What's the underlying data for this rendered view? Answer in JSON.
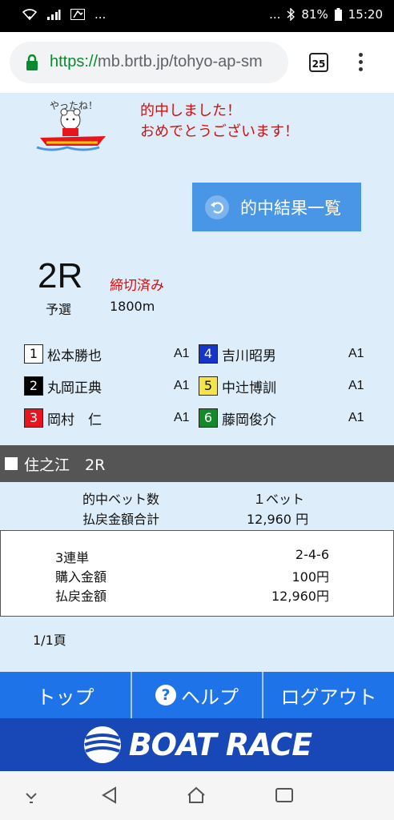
{
  "status_bar": {
    "left_dots": "...",
    "right_dots": "...",
    "battery": "81%",
    "time": "15:20"
  },
  "browser": {
    "url_scheme": "https://",
    "url_rest": "mb.brtb.jp/tohyo-ap-sm",
    "tab_count": "25"
  },
  "congrats": {
    "mascot_text": "やったね！",
    "line1": "的中しました！",
    "line2": "おめでとうございます！"
  },
  "result_button": {
    "label": "的中結果一覧"
  },
  "race": {
    "number": "2R",
    "status": "締切済み",
    "type": "予選",
    "distance": "1800m"
  },
  "racers": [
    {
      "no": "1",
      "name": "松本勝也",
      "class": "A1",
      "bg": "#ffffff",
      "fg": "#111111"
    },
    {
      "no": "2",
      "name": "丸岡正典",
      "class": "A1",
      "bg": "#000000",
      "fg": "#ffffff"
    },
    {
      "no": "3",
      "name": "岡村　仁",
      "class": "A1",
      "bg": "#e8141e",
      "fg": "#ffffff"
    },
    {
      "no": "4",
      "name": "吉川昭男",
      "class": "A1",
      "bg": "#1535c9",
      "fg": "#ffffff"
    },
    {
      "no": "5",
      "name": "中辻博訓",
      "class": "A1",
      "bg": "#f4e447",
      "fg": "#111111"
    },
    {
      "no": "6",
      "name": "藤岡俊介",
      "class": "A1",
      "bg": "#138a2a",
      "fg": "#ffffff"
    }
  ],
  "stadium": {
    "label": "住之江　2R"
  },
  "summary": {
    "bets_label": "的中ベット数",
    "bets_value": "１ベット",
    "payout_label": "払戻金額合計",
    "payout_value": "12,960 円"
  },
  "detail": {
    "type_label": "3連単",
    "type_value": "2-4-6",
    "buy_label": "購入金額",
    "buy_value": "100円",
    "payout_label": "払戻金額",
    "payout_value": "12,960円"
  },
  "pagination": {
    "text": "1/1頁"
  },
  "nav": {
    "top": "トップ",
    "help": "ヘルプ",
    "logout": "ログアウト"
  },
  "brand": {
    "text": "BOAT RACE"
  },
  "colors": {
    "accent_blue": "#1f73e8",
    "result_button": "#4a96e6",
    "brand_blue": "#1848b8",
    "alert_red": "#d01010",
    "page_bg": "#ddeefa"
  }
}
